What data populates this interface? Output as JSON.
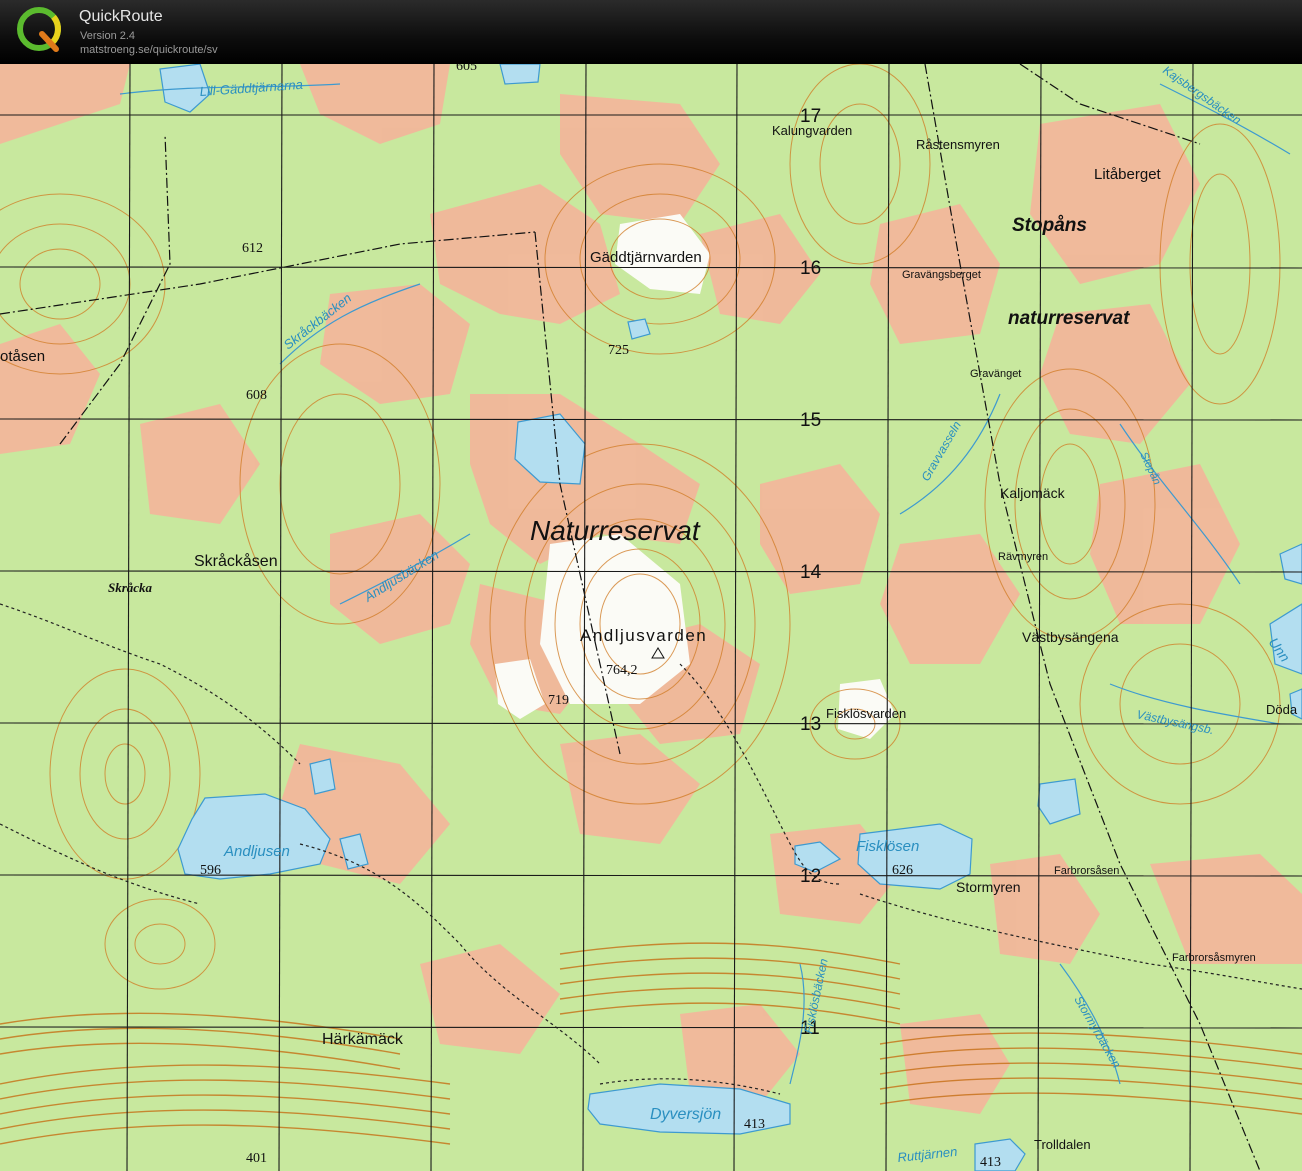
{
  "app": {
    "name": "QuickRoute",
    "version": "Version 2.4",
    "url": "matstroeng.se/quickroute/sv"
  },
  "map": {
    "colors": {
      "forest": "#c8e89e",
      "open": "#f4b59a",
      "water": "#b3def0",
      "water_outline": "#3d9ad0",
      "contour": "#d07a22",
      "grid": "#1a1a1a",
      "bare_rock": "#fbfbf6"
    },
    "grid_numbers": [
      "17",
      "16",
      "15",
      "14",
      "13",
      "12",
      "11"
    ],
    "place_names": [
      "Lill-Gäddtjärnarna",
      "Kalungvarden",
      "Råstensmyren",
      "Litåberget",
      "Stopåns",
      "naturreservat",
      "Gäddtjärnvarden",
      "Gravängsberget",
      "Gravänget",
      "Kaljomäck",
      "Rävmyren",
      "Naturreservat",
      "Skråckåsen",
      "Skråcka",
      "Andljusvarden",
      "Västbysängena",
      "Fisklösvarden",
      "Döda",
      "Farbrorsåsen",
      "Stormyren",
      "Farbrorsåsmyren",
      "Härkämäck",
      "Trolldalen",
      "otåsen"
    ],
    "water_names": [
      "Skråckbäcken",
      "Andljusbäcken",
      "Gravvasseln",
      "Andljusen",
      "Fisklösen",
      "Fisklösbäcken",
      "Stormyrbäcken",
      "Dyversjön",
      "Ruttjärnen",
      "Kajsbergsbäcken",
      "Stopån",
      "Västbysängsb.",
      "Unn"
    ],
    "elevations": [
      "605",
      "612",
      "608",
      "725",
      "764,2",
      "719",
      "596",
      "626",
      "413",
      "413",
      "401"
    ]
  }
}
